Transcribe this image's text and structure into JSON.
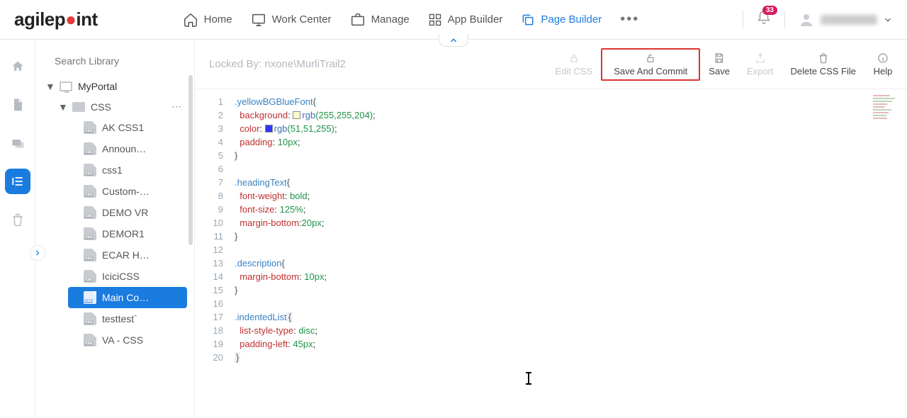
{
  "brand": {
    "name_a": "agilep",
    "name_b": "int"
  },
  "nav": {
    "home": "Home",
    "work_center": "Work Center",
    "manage": "Manage",
    "app_builder": "App Builder",
    "page_builder": "Page Builder"
  },
  "notifications": {
    "count": "33"
  },
  "search": {
    "placeholder": "Search Library"
  },
  "tree": {
    "root": "MyPortal",
    "folder": "CSS",
    "files": [
      "AK CSS1",
      "Announ…",
      "css1",
      "Custom-…",
      "DEMO VR",
      "DEMOR1",
      "ECAR H…",
      "IciciCSS",
      "Main Co…",
      "testtest`",
      "VA - CSS"
    ]
  },
  "toolbar": {
    "locked_by": "Locked By: nxone\\MurliTrail2",
    "edit_css": "Edit CSS",
    "save_commit": "Save And Commit",
    "save": "Save",
    "export": "Export",
    "delete": "Delete CSS File",
    "help": "Help"
  },
  "code": {
    "lines": 20,
    "l1_sel": ".yellowBGBlueFont",
    "l2_prop": "background",
    "l2_func": "rgb",
    "l2_args": "(255,255,204)",
    "l2_swatch": "#FFFFCC",
    "l3_prop": "color",
    "l3_func": "rgb",
    "l3_args": "(51,51,255)",
    "l3_swatch": "#3333FF",
    "l4_prop": "padding",
    "l4_val": "10px",
    "l7_sel": ".headingText",
    "l8_prop": "font-weight",
    "l8_val": "bold",
    "l9_prop": "font-size",
    "l9_val": "125%",
    "l10_prop": "margin-bottom",
    "l10_val": "20px",
    "l13_sel": ".description",
    "l14_prop": "margin-bottom",
    "l14_val": "10px",
    "l17_sel": ".indentedList",
    "l18_prop": "list-style-type",
    "l18_val": "disc",
    "l19_prop": "padding-left",
    "l19_val": "45px"
  }
}
